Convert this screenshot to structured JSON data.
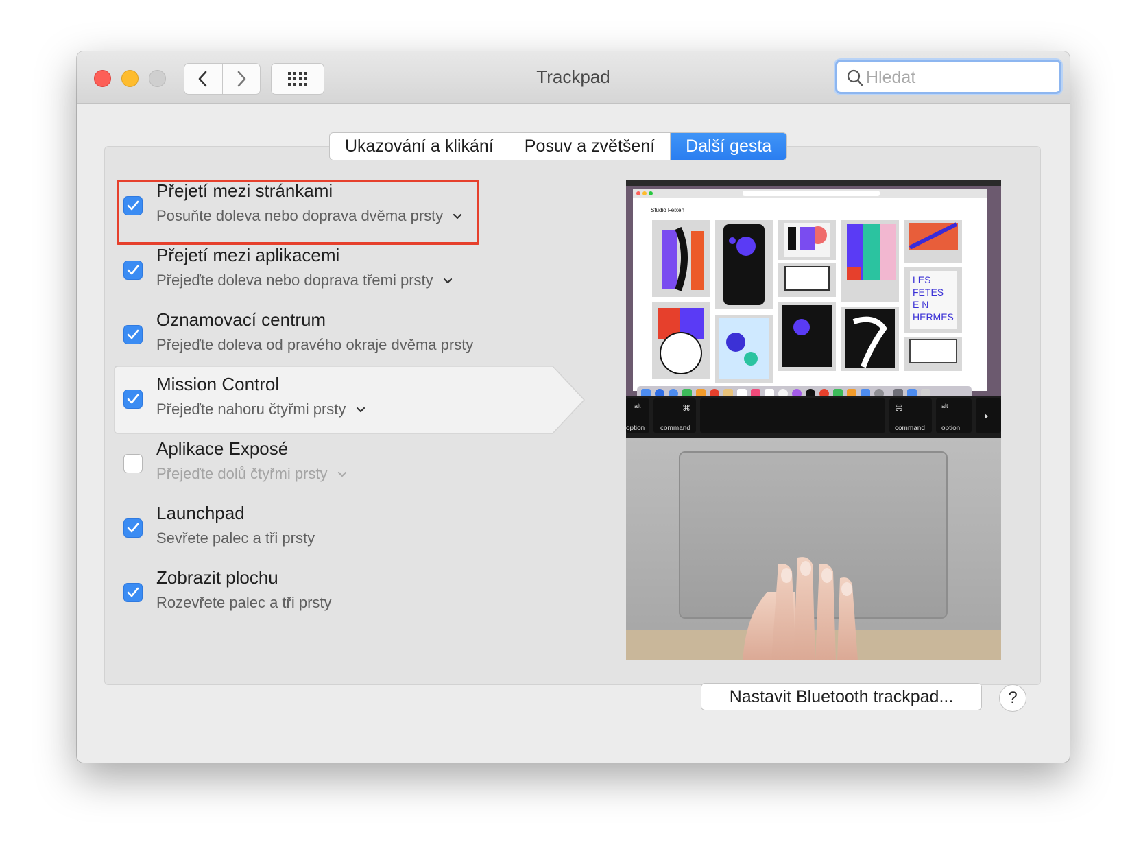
{
  "window": {
    "title": "Trackpad"
  },
  "titlebar": {
    "back_icon": "chevron-left-icon",
    "forward_icon": "chevron-right-icon",
    "grid_icon": "grid-icon"
  },
  "search": {
    "placeholder": "Hledat",
    "value": ""
  },
  "tabs": [
    {
      "label": "Ukazování a klikání",
      "active": false
    },
    {
      "label": "Posuv a zvětšení",
      "active": false
    },
    {
      "label": "Další gesta",
      "active": true
    }
  ],
  "gestures": [
    {
      "title": "Přejetí mezi stránkami",
      "subtitle": "Posuňte doleva nebo doprava dvěma prsty",
      "checked": true,
      "dropdown": true
    },
    {
      "title": "Přejetí mezi aplikacemi",
      "subtitle": "Přejeďte doleva nebo doprava třemi prsty",
      "checked": true,
      "dropdown": true
    },
    {
      "title": "Oznamovací centrum",
      "subtitle": "Přejeďte doleva od pravého okraje dvěma prsty",
      "checked": true,
      "dropdown": false
    },
    {
      "title": "Mission Control",
      "subtitle": "Přejeďte nahoru čtyřmi prsty",
      "checked": true,
      "dropdown": true
    },
    {
      "title": "Aplikace Exposé",
      "subtitle": "Přejeďte dolů čtyřmi prsty",
      "checked": false,
      "dropdown": true
    },
    {
      "title": "Launchpad",
      "subtitle": "Sevřete palec a tři prsty",
      "checked": true,
      "dropdown": false
    },
    {
      "title": "Zobrazit plochu",
      "subtitle": "Rozevřete palec a tři prsty",
      "checked": true,
      "dropdown": false
    }
  ],
  "preview": {
    "site_name": "Studio Feixen",
    "keys": {
      "option_left": "option",
      "alt_left": "alt",
      "command_left": "command",
      "cmd_symbol": "⌘",
      "command_right": "command",
      "alt_right": "alt",
      "option_right": "option"
    }
  },
  "footer": {
    "bluetooth_button": "Nastavit Bluetooth trackpad...",
    "help_button": "?"
  },
  "colors": {
    "accent": "#2b7ef0",
    "highlight_box": "#e6402c",
    "checkbox_on": "#3b8cf3"
  }
}
